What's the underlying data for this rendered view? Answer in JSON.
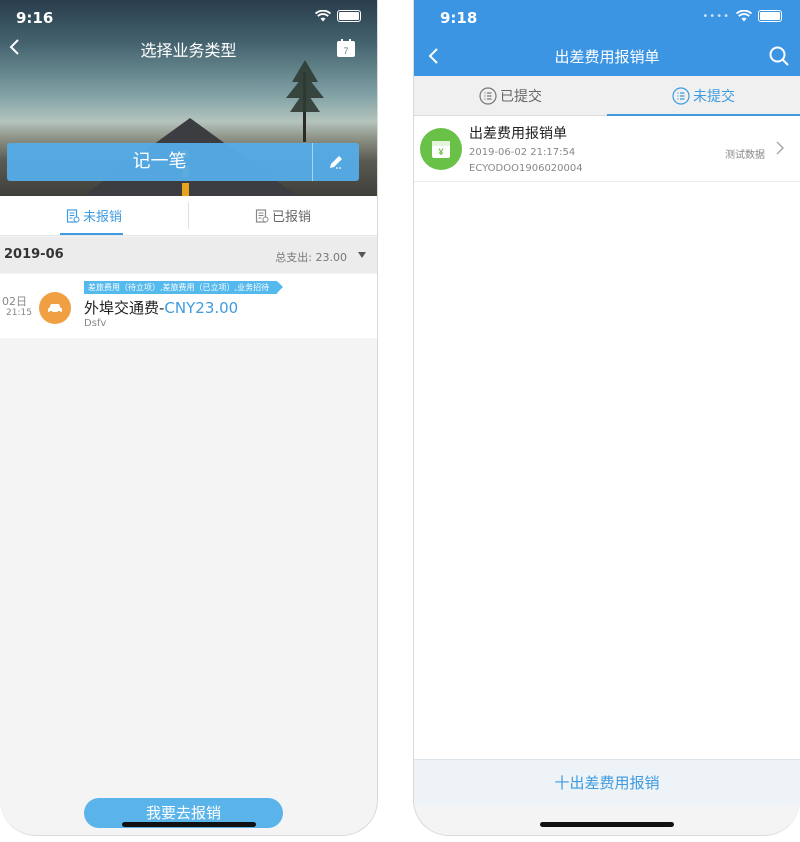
{
  "left": {
    "status_time": "9:16",
    "nav_title": "选择业务类型",
    "record_button": "记一笔",
    "tabs": [
      {
        "label": "未报销",
        "active": true
      },
      {
        "label": "已报销",
        "active": false
      }
    ],
    "month": "2019-06",
    "total_label": "总支出: 23.00",
    "expense": {
      "day": "02日",
      "time": "21:15",
      "tags": "差旅费用（待立项）,差旅费用（已立项）,业务招待",
      "title": "外埠交通费-",
      "amount": "CNY23.00",
      "description": "Dsfv"
    },
    "reimburse_button": "我要去报销"
  },
  "right": {
    "status_time": "9:18",
    "nav_title": "出差费用报销单",
    "tabs": [
      {
        "label": "已提交",
        "active": false
      },
      {
        "label": "未提交",
        "active": true
      }
    ],
    "document": {
      "name": "出差费用报销单",
      "datetime": "2019-06-02 21:17:54",
      "code": "ECYODOO1906020004",
      "tag": "测试数据"
    },
    "add_button": "十出差费用报销"
  },
  "colors": {
    "accent": "#3e9be0",
    "header_blue": "#3c95e3",
    "doc_icon_green": "#6ac148",
    "car_icon_orange": "#f0a042"
  }
}
